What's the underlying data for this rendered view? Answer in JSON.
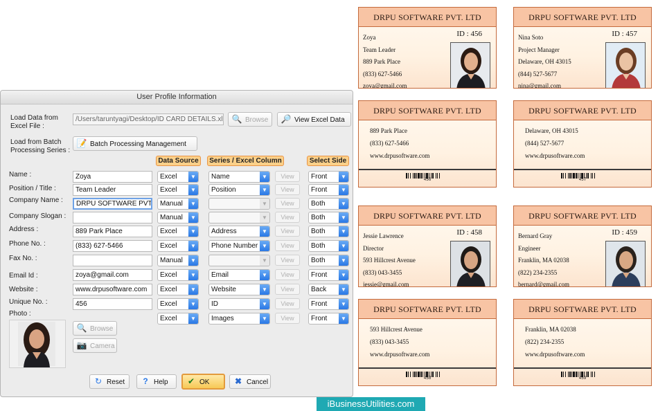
{
  "dialog": {
    "title": "User Profile Information",
    "load_excel_label": "Load Data from Excel File :",
    "excel_path": "/Users/taruntyagi/Desktop/ID CARD DETAILS.xlsx",
    "browse_label": "Browse",
    "view_excel_label": "View Excel Data",
    "batch_label": "Load from Batch Processing Series :",
    "batch_button": "Batch Processing Management",
    "headers": {
      "data_source": "Data Source",
      "series": "Series / Excel Column",
      "side": "Select Side"
    },
    "view_label": "View",
    "rows": [
      {
        "label": "Name :",
        "value": "Zoya",
        "source": "Excel",
        "column": "Name",
        "side": "Front"
      },
      {
        "label": "Position / Title :",
        "value": "Team Leader",
        "source": "Excel",
        "column": "Position",
        "side": "Front"
      },
      {
        "label": "Company Name :",
        "value": "DRPU SOFTWARE PVT. LTD",
        "source": "Manual",
        "column": "",
        "side": "Both"
      },
      {
        "label": "Company Slogan :",
        "value": "",
        "source": "Manual",
        "column": "",
        "side": "Both"
      },
      {
        "label": "Address :",
        "value": "889 Park Place",
        "source": "Excel",
        "column": "Address",
        "side": "Both"
      },
      {
        "label": "Phone No. :",
        "value": "(833) 627-5466",
        "source": "Excel",
        "column": "Phone Number",
        "side": "Both"
      },
      {
        "label": "Fax No. :",
        "value": "",
        "source": "Manual",
        "column": "",
        "side": "Both"
      },
      {
        "label": "Email Id :",
        "value": "zoya@gmail.com",
        "source": "Excel",
        "column": "Email",
        "side": "Front"
      },
      {
        "label": "Website :",
        "value": "www.drpusoftware.com",
        "source": "Excel",
        "column": "Website",
        "side": "Back"
      },
      {
        "label": "Unique No. :",
        "value": "456",
        "source": "Excel",
        "column": "ID",
        "side": "Front"
      },
      {
        "label": "Photo :",
        "value": "",
        "source": "Excel",
        "column": "Images",
        "side": "Front"
      }
    ],
    "photo_browse": "Browse",
    "camera": "Camera",
    "reset": "Reset",
    "help": "Help",
    "ok": "OK",
    "cancel": "Cancel"
  },
  "cards": [
    {
      "company": "DRPU SOFTWARE PVT. LTD",
      "id": "ID :  456",
      "name": "Zoya",
      "title": "Team Leader",
      "address": "889 Park Place",
      "phone": "(833) 627-5466",
      "email": "zoya@gmail.com",
      "web": "www.drpusoftware.com",
      "barcode": "456"
    },
    {
      "company": "DRPU SOFTWARE PVT. LTD",
      "id": "ID :  457",
      "name": "Nina Soto",
      "title": "Project Manager",
      "address": "Delaware, OH 43015",
      "phone": "(844) 527-5677",
      "email": "nina@gmail.com",
      "web": "www.drpusoftware.com",
      "barcode": "457"
    },
    {
      "company": "DRPU SOFTWARE PVT. LTD",
      "id": "ID :  458",
      "name": "Jessie Lawrence",
      "title": "Director",
      "address": "593 Hillcrest Avenue",
      "phone": "(833) 043-3455",
      "email": "jessie@gmail.com",
      "web": "www.drpusoftware.com",
      "barcode": "458"
    },
    {
      "company": "DRPU SOFTWARE PVT. LTD",
      "id": "ID :  459",
      "name": "Bernard Gray",
      "title": "Engineer",
      "address": "Franklin, MA 02038",
      "phone": "(822) 234-2355",
      "email": "bernard@gmail.com",
      "web": "www.drpusoftware.com",
      "barcode": "459"
    }
  ],
  "colors": {
    "header_fill": "#fbd089",
    "header_border": "#e89448",
    "card_head": "#f8c4a4",
    "accent": "#2a78e6",
    "brand": "#1fa9b3"
  },
  "brand": "iBusinessUtilities.com"
}
